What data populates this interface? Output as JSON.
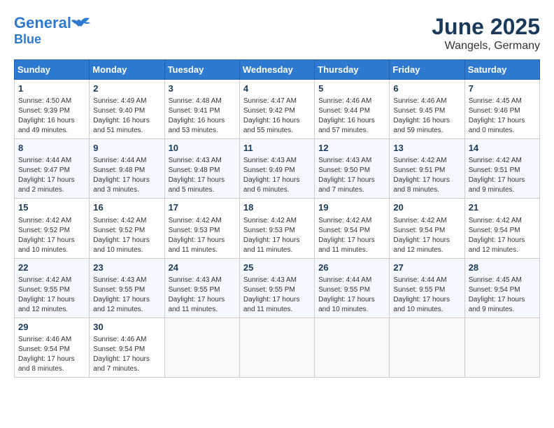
{
  "header": {
    "logo_line1": "General",
    "logo_line2": "Blue",
    "month": "June 2025",
    "location": "Wangels, Germany"
  },
  "weekdays": [
    "Sunday",
    "Monday",
    "Tuesday",
    "Wednesday",
    "Thursday",
    "Friday",
    "Saturday"
  ],
  "weeks": [
    [
      {
        "day": "1",
        "sunrise": "4:50 AM",
        "sunset": "9:39 PM",
        "daylight": "16 hours and 49 minutes."
      },
      {
        "day": "2",
        "sunrise": "4:49 AM",
        "sunset": "9:40 PM",
        "daylight": "16 hours and 51 minutes."
      },
      {
        "day": "3",
        "sunrise": "4:48 AM",
        "sunset": "9:41 PM",
        "daylight": "16 hours and 53 minutes."
      },
      {
        "day": "4",
        "sunrise": "4:47 AM",
        "sunset": "9:42 PM",
        "daylight": "16 hours and 55 minutes."
      },
      {
        "day": "5",
        "sunrise": "4:46 AM",
        "sunset": "9:44 PM",
        "daylight": "16 hours and 57 minutes."
      },
      {
        "day": "6",
        "sunrise": "4:46 AM",
        "sunset": "9:45 PM",
        "daylight": "16 hours and 59 minutes."
      },
      {
        "day": "7",
        "sunrise": "4:45 AM",
        "sunset": "9:46 PM",
        "daylight": "17 hours and 0 minutes."
      }
    ],
    [
      {
        "day": "8",
        "sunrise": "4:44 AM",
        "sunset": "9:47 PM",
        "daylight": "17 hours and 2 minutes."
      },
      {
        "day": "9",
        "sunrise": "4:44 AM",
        "sunset": "9:48 PM",
        "daylight": "17 hours and 3 minutes."
      },
      {
        "day": "10",
        "sunrise": "4:43 AM",
        "sunset": "9:48 PM",
        "daylight": "17 hours and 5 minutes."
      },
      {
        "day": "11",
        "sunrise": "4:43 AM",
        "sunset": "9:49 PM",
        "daylight": "17 hours and 6 minutes."
      },
      {
        "day": "12",
        "sunrise": "4:43 AM",
        "sunset": "9:50 PM",
        "daylight": "17 hours and 7 minutes."
      },
      {
        "day": "13",
        "sunrise": "4:42 AM",
        "sunset": "9:51 PM",
        "daylight": "17 hours and 8 minutes."
      },
      {
        "day": "14",
        "sunrise": "4:42 AM",
        "sunset": "9:51 PM",
        "daylight": "17 hours and 9 minutes."
      }
    ],
    [
      {
        "day": "15",
        "sunrise": "4:42 AM",
        "sunset": "9:52 PM",
        "daylight": "17 hours and 10 minutes."
      },
      {
        "day": "16",
        "sunrise": "4:42 AM",
        "sunset": "9:52 PM",
        "daylight": "17 hours and 10 minutes."
      },
      {
        "day": "17",
        "sunrise": "4:42 AM",
        "sunset": "9:53 PM",
        "daylight": "17 hours and 11 minutes."
      },
      {
        "day": "18",
        "sunrise": "4:42 AM",
        "sunset": "9:53 PM",
        "daylight": "17 hours and 11 minutes."
      },
      {
        "day": "19",
        "sunrise": "4:42 AM",
        "sunset": "9:54 PM",
        "daylight": "17 hours and 11 minutes."
      },
      {
        "day": "20",
        "sunrise": "4:42 AM",
        "sunset": "9:54 PM",
        "daylight": "17 hours and 12 minutes."
      },
      {
        "day": "21",
        "sunrise": "4:42 AM",
        "sunset": "9:54 PM",
        "daylight": "17 hours and 12 minutes."
      }
    ],
    [
      {
        "day": "22",
        "sunrise": "4:42 AM",
        "sunset": "9:55 PM",
        "daylight": "17 hours and 12 minutes."
      },
      {
        "day": "23",
        "sunrise": "4:43 AM",
        "sunset": "9:55 PM",
        "daylight": "17 hours and 12 minutes."
      },
      {
        "day": "24",
        "sunrise": "4:43 AM",
        "sunset": "9:55 PM",
        "daylight": "17 hours and 11 minutes."
      },
      {
        "day": "25",
        "sunrise": "4:43 AM",
        "sunset": "9:55 PM",
        "daylight": "17 hours and 11 minutes."
      },
      {
        "day": "26",
        "sunrise": "4:44 AM",
        "sunset": "9:55 PM",
        "daylight": "17 hours and 10 minutes."
      },
      {
        "day": "27",
        "sunrise": "4:44 AM",
        "sunset": "9:55 PM",
        "daylight": "17 hours and 10 minutes."
      },
      {
        "day": "28",
        "sunrise": "4:45 AM",
        "sunset": "9:54 PM",
        "daylight": "17 hours and 9 minutes."
      }
    ],
    [
      {
        "day": "29",
        "sunrise": "4:46 AM",
        "sunset": "9:54 PM",
        "daylight": "17 hours and 8 minutes."
      },
      {
        "day": "30",
        "sunrise": "4:46 AM",
        "sunset": "9:54 PM",
        "daylight": "17 hours and 7 minutes."
      },
      null,
      null,
      null,
      null,
      null
    ]
  ]
}
